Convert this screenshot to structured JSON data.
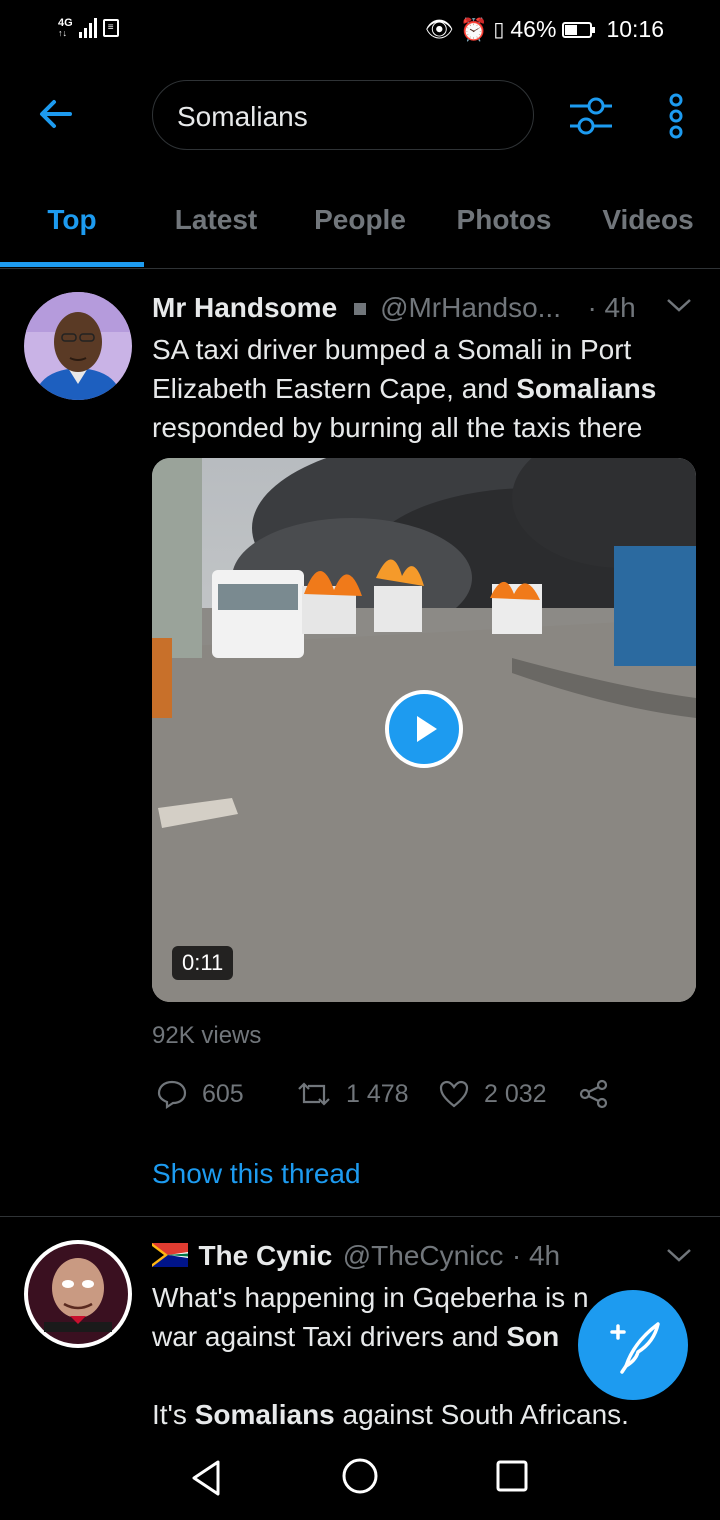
{
  "status_bar": {
    "network": "4G",
    "battery_percent": "46%",
    "battery_level": 0.46,
    "time": "10:16"
  },
  "search": {
    "query": "Somalians"
  },
  "tabs": [
    {
      "label": "Top",
      "active": true
    },
    {
      "label": "Latest",
      "active": false
    },
    {
      "label": "People",
      "active": false
    },
    {
      "label": "Photos",
      "active": false
    },
    {
      "label": "Videos",
      "active": false
    }
  ],
  "tweet1": {
    "name": "Mr Handsome",
    "handle": "@MrHandso...",
    "time": "· 4h",
    "text_1": "SA taxi driver bumped a Somali in Port",
    "text_2a": "Elizabeth Eastern Cape, and ",
    "text_2b": "Somalians",
    "text_3": "responded by burning all the taxis there",
    "video_duration": "0:11",
    "views": "92K views",
    "replies": "605",
    "retweets": "1 478",
    "likes": "2 032",
    "show_thread": "Show this thread"
  },
  "tweet2": {
    "name": "The Cynic",
    "handle": "@TheCynicc",
    "time": "· 4h",
    "line1": "What's happening in Gqeberha is n",
    "line2a": "war against Taxi drivers and ",
    "line2b": "Son",
    "line3a": "It's ",
    "line3b": "Somalians",
    "line3c": " against South Africans."
  },
  "colors": {
    "accent": "#1d9bf0",
    "muted": "#71767b",
    "text": "#e7e9ea",
    "background": "#000000"
  },
  "icons": [
    "back-arrow-icon",
    "filter-icon",
    "more-vertical-icon",
    "reply-icon",
    "retweet-icon",
    "like-icon",
    "share-icon",
    "compose-icon",
    "chevron-down-icon",
    "play-icon"
  ]
}
